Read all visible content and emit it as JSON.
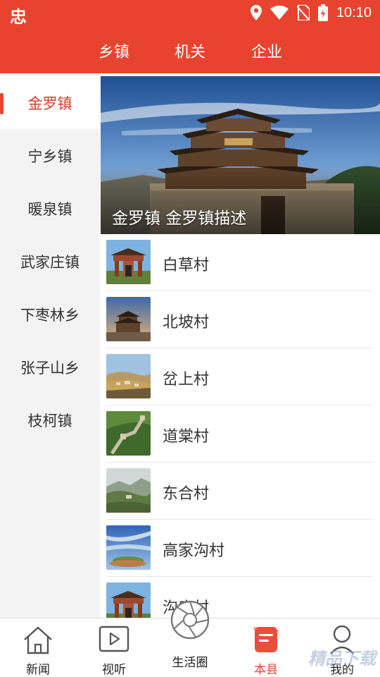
{
  "status_bar": {
    "app_glyph": "忠",
    "time": "10:10"
  },
  "top_tabs": [
    {
      "label": "乡镇"
    },
    {
      "label": "机关"
    },
    {
      "label": "企业"
    }
  ],
  "sidebar": {
    "active_index": 0,
    "items": [
      {
        "label": "金罗镇"
      },
      {
        "label": "宁乡镇"
      },
      {
        "label": "暖泉镇"
      },
      {
        "label": "武家庄镇"
      },
      {
        "label": "下枣林乡"
      },
      {
        "label": "张子山乡"
      },
      {
        "label": "枝柯镇"
      }
    ]
  },
  "banner": {
    "caption": "金罗镇 金罗镇描述"
  },
  "villages": [
    {
      "name": "白草村",
      "thumb": "gate-icon"
    },
    {
      "name": "北坡村",
      "thumb": "tower-icon"
    },
    {
      "name": "岔上村",
      "thumb": "hill-town-icon"
    },
    {
      "name": "道棠村",
      "thumb": "great-wall-icon"
    },
    {
      "name": "东合村",
      "thumb": "mountain-icon"
    },
    {
      "name": "高家沟村",
      "thumb": "sky-island-icon"
    },
    {
      "name": "沟底村",
      "thumb": "gate-icon"
    }
  ],
  "bottom_nav": {
    "active_index": 3,
    "items": [
      {
        "label": "新闻",
        "icon": "home-icon"
      },
      {
        "label": "视听",
        "icon": "play-icon"
      },
      {
        "label": "生活圈",
        "icon": "aperture-icon"
      },
      {
        "label": "本县",
        "icon": "document-icon"
      },
      {
        "label": "我的",
        "icon": "user-icon"
      }
    ]
  },
  "watermark": "精品下载",
  "colors": {
    "brand_red": "#e8432f",
    "active_text": "#d9392b"
  }
}
